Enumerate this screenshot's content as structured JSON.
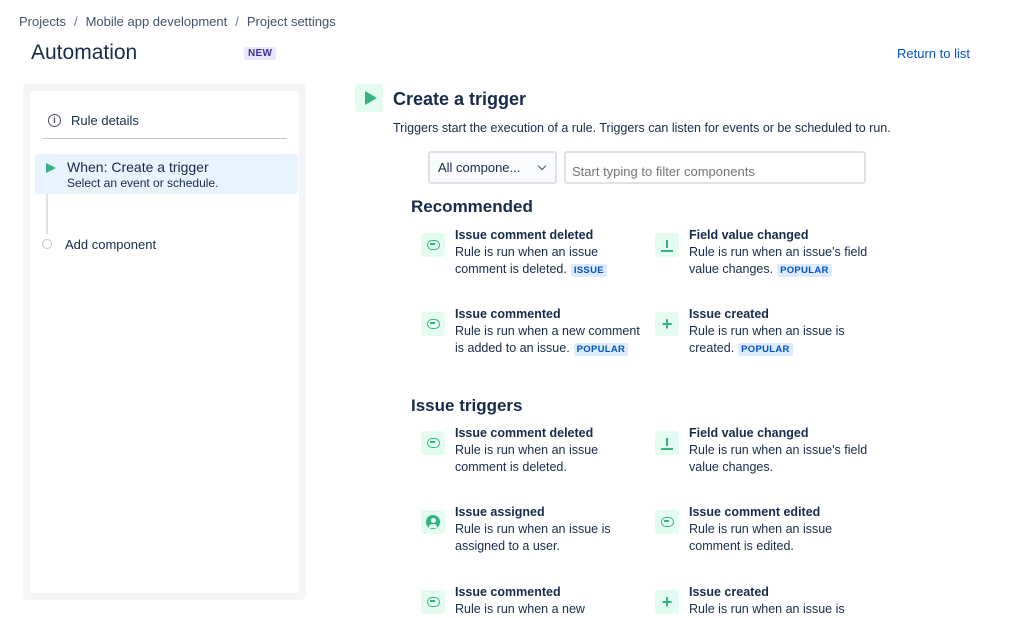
{
  "breadcrumb": [
    "Projects",
    "Mobile app development",
    "Project settings"
  ],
  "breadcrumb_sep": "/",
  "header": {
    "title": "Automation",
    "badge": "NEW",
    "return_link": "Return to list"
  },
  "sidebar": {
    "rule_details": "Rule details",
    "step": {
      "title": "When: Create a trigger",
      "subtitle": "Select an event or schedule."
    },
    "add_component": "Add component"
  },
  "main": {
    "title": "Create a trigger",
    "description": "Triggers start the execution of a rule. Triggers can listen for events or be scheduled to run.",
    "select_value": "All compone...",
    "filter_placeholder": "Start typing to filter components",
    "sections": [
      {
        "title": "Recommended",
        "items": [
          {
            "icon": "comment-icon",
            "name": "Issue comment deleted",
            "desc": "Rule is run when an issue comment is deleted.",
            "badge": "ISSUE"
          },
          {
            "icon": "field-download-icon",
            "name": "Field value changed",
            "desc": "Rule is run when an issue's field value changes.",
            "badge": "POPULAR"
          },
          {
            "icon": "comment-icon",
            "name": "Issue commented",
            "desc": "Rule is run when a new comment is added to an issue.",
            "badge": "POPULAR"
          },
          {
            "icon": "plus-icon",
            "name": "Issue created",
            "desc": "Rule is run when an issue is created.",
            "badge": "POPULAR"
          }
        ]
      },
      {
        "title": "Issue triggers",
        "items": [
          {
            "icon": "comment-icon",
            "name": "Issue comment deleted",
            "desc": "Rule is run when an issue comment is deleted.",
            "badge": ""
          },
          {
            "icon": "field-download-icon",
            "name": "Field value changed",
            "desc": "Rule is run when an issue's field value changes.",
            "badge": ""
          },
          {
            "icon": "person-icon",
            "name": "Issue assigned",
            "desc": "Rule is run when an issue is assigned to a user.",
            "badge": ""
          },
          {
            "icon": "comment-icon",
            "name": "Issue comment edited",
            "desc": "Rule is run when an issue comment is edited.",
            "badge": ""
          },
          {
            "icon": "comment-icon",
            "name": "Issue commented",
            "desc": "Rule is run when a new",
            "badge": ""
          },
          {
            "icon": "plus-icon",
            "name": "Issue created",
            "desc": "Rule is run when an issue is",
            "badge": ""
          }
        ]
      }
    ]
  },
  "colors": {
    "accent": "#36b37e",
    "link": "#0052cc",
    "badge_bg": "#deebff",
    "active_bg": "#e9f2ff"
  }
}
